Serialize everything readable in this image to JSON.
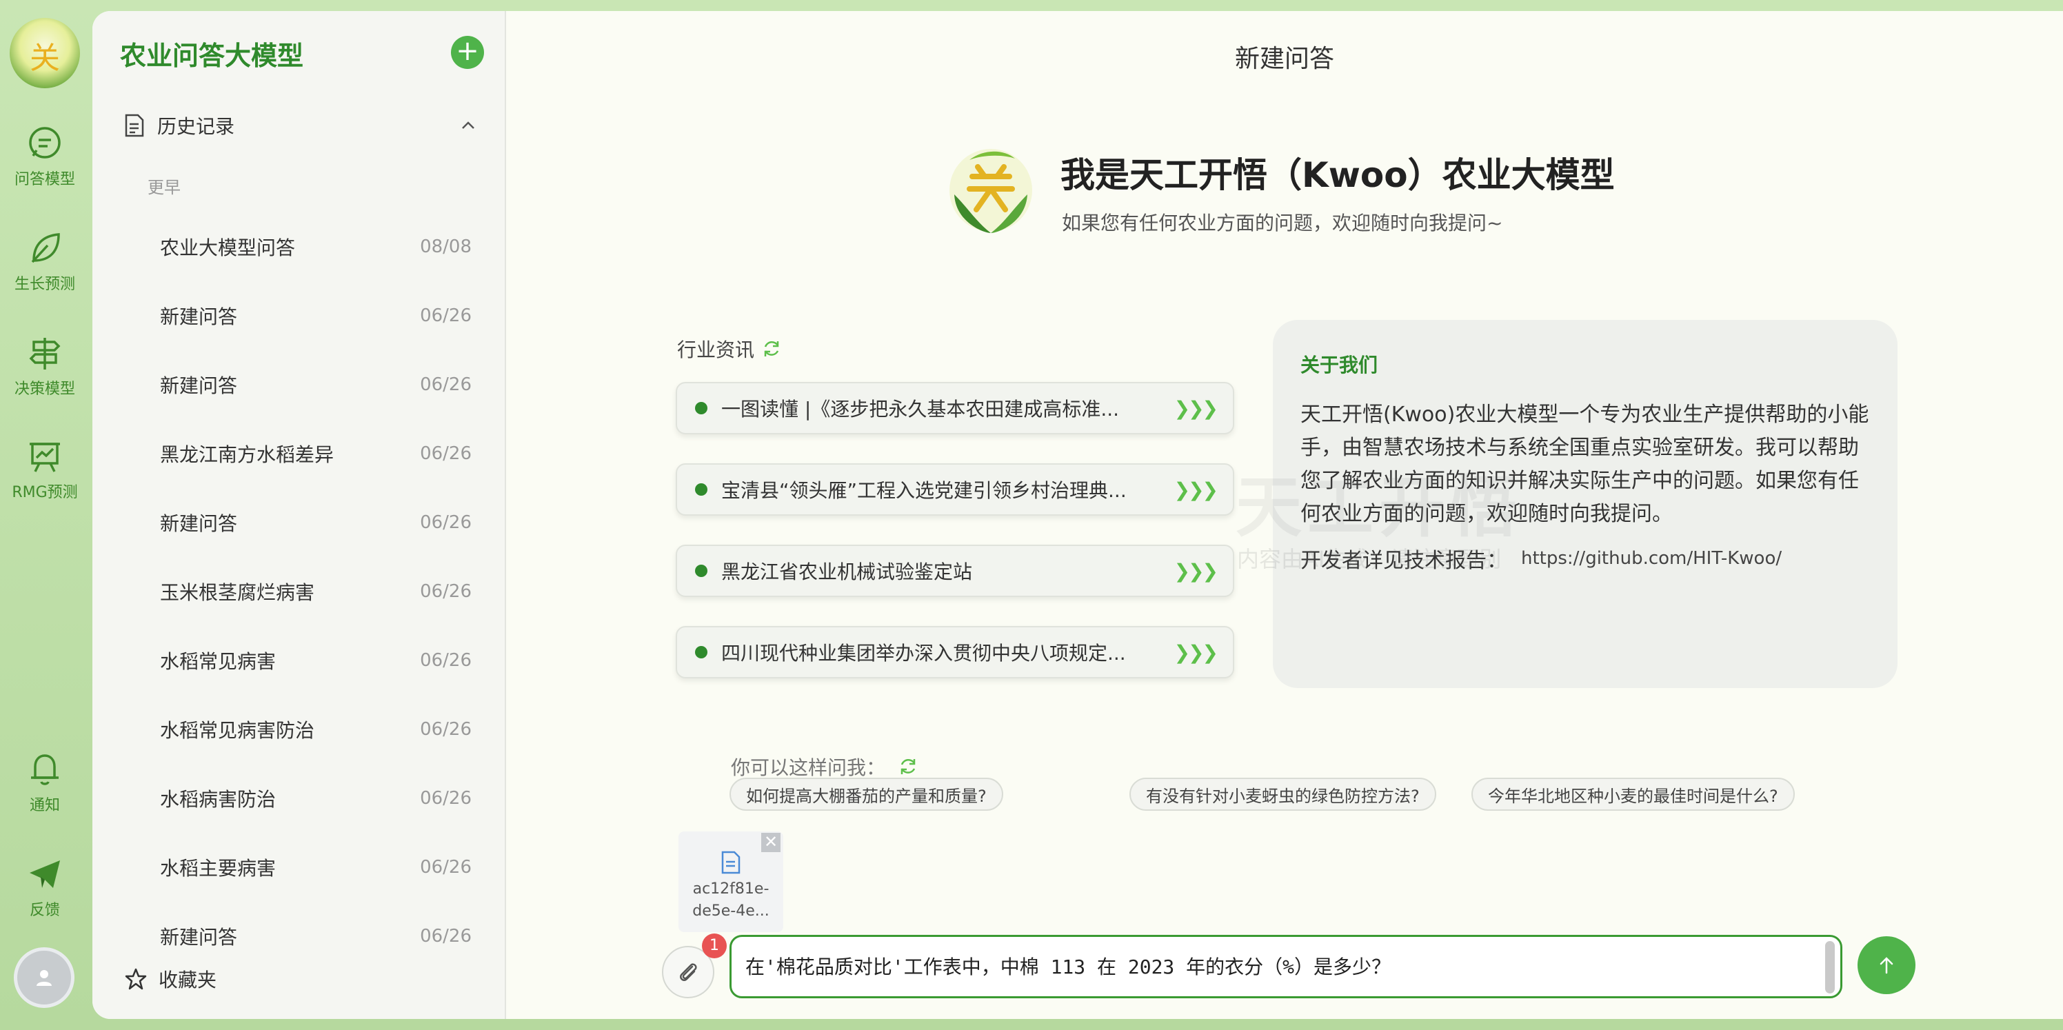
{
  "rail": {
    "logo_glyph": "关",
    "items": [
      {
        "label": "问答模型",
        "icon": "chat-bubble-icon"
      },
      {
        "label": "生长预测",
        "icon": "leaf-icon"
      },
      {
        "label": "决策模型",
        "icon": "signpost-icon"
      },
      {
        "label": "RMG预测",
        "icon": "presentation-board-icon"
      },
      {
        "label": "通知",
        "icon": "bell-icon"
      },
      {
        "label": "反馈",
        "icon": "paper-plane-icon"
      }
    ]
  },
  "sidebar": {
    "title": "农业问答大模型",
    "add_label": "+",
    "history_label": "历史记录",
    "earlier_label": "更早",
    "items": [
      {
        "name": "农业大模型问答",
        "date": "08/08"
      },
      {
        "name": "新建问答",
        "date": "06/26"
      },
      {
        "name": "新建问答",
        "date": "06/26"
      },
      {
        "name": "黑龙江南方水稻差异",
        "date": "06/26"
      },
      {
        "name": "新建问答",
        "date": "06/26"
      },
      {
        "name": "玉米根茎腐烂病害",
        "date": "06/26"
      },
      {
        "name": "水稻常见病害",
        "date": "06/26"
      },
      {
        "name": "水稻常见病害防治",
        "date": "06/26"
      },
      {
        "name": "水稻病害防治",
        "date": "06/26"
      },
      {
        "name": "水稻主要病害",
        "date": "06/26"
      },
      {
        "name": "新建问答",
        "date": "06/26"
      }
    ],
    "favorites_label": "收藏夹"
  },
  "main": {
    "page_title": "新建问答",
    "hero_title": "我是天工开悟（Kwoo）农业大模型",
    "hero_subtitle": "如果您有任何农业方面的问题，欢迎随时向我提问~",
    "news_label": "行业资讯",
    "news": [
      "一图读懂 |《逐步把永久基本农田建成高标准...",
      "宝清县“领头雁”工程入选党建引领乡村治理典...",
      "黑龙江省农业机械试验鉴定站",
      "四川现代种业集团举办深入贯彻中央八项规定..."
    ],
    "news_arrow": "❯❯❯",
    "about": {
      "title": "关于我们",
      "text": "天工开悟(Kwoo)农业大模型一个专为农业生产提供帮助的小能手，由智慧农场技术与系统全国重点实验室研发。我可以帮助您了解农业方面的知识并解决实际生产中的问题。如果您有任何农业方面的问题，欢迎随时向我提问。",
      "dev_label": "开发者详见技术报告：",
      "dev_link": "https://github.com/HIT-Kwoo/"
    },
    "watermark_title": "天工开悟",
    "watermark_note": "内容由AI生成，请注意甄别",
    "ask_label": "你可以这样问我：",
    "suggestions": [
      "如何提高大棚番茄的产量和质量?",
      "有没有针对小麦蚜虫的绿色防控方法?",
      "今年华北地区种小麦的最佳时间是什么?"
    ],
    "attachment": {
      "name_line1": "ac12f81e-",
      "name_line2": "de5e-4e...",
      "close": "✕"
    },
    "badge_count": "1",
    "input_value": "在'棉花品质对比'工作表中，中棉 113 在 2023 年的衣分（%）是多少？"
  },
  "colors": {
    "accent": "#4fb34a",
    "brand_dark": "#2f8a2c",
    "badge": "#e85353"
  }
}
